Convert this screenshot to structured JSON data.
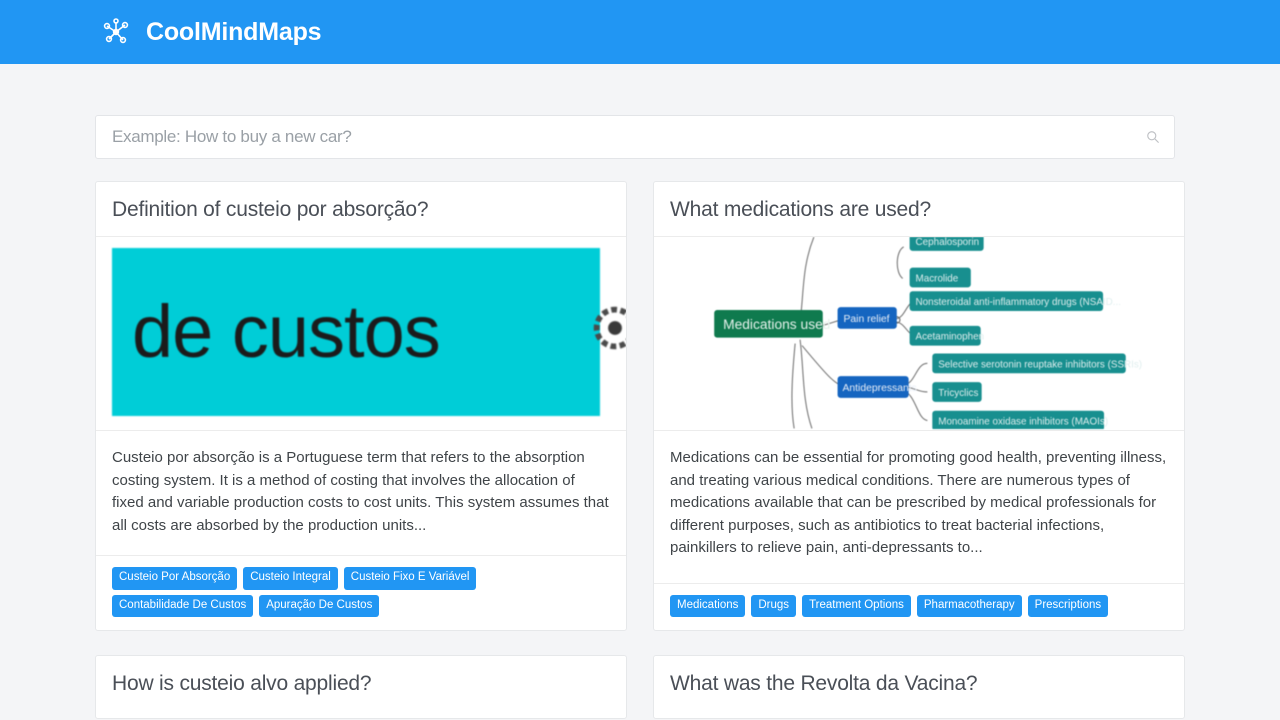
{
  "header": {
    "brand_name": "CoolMindMaps",
    "brand_icon": "network-nodes-icon",
    "background_color": "#2196f3"
  },
  "search": {
    "placeholder": "Example: How to buy a new car?",
    "value": "",
    "icon": "search-icon"
  },
  "theme": {
    "page_background": "#f4f5f7",
    "accent": "#2196f3",
    "card_background": "#ffffff",
    "tag_background": "#2196f3",
    "tag_text": "#ffffff"
  },
  "cards": [
    {
      "title": "Definition of custeio por absorção?",
      "thumbnail": {
        "type": "zoomed-text-banner",
        "text": "de custos",
        "background_color": "#00cdd7",
        "text_color": "#1b1b1b",
        "extra_icon": "gear-icon"
      },
      "description": "Custeio por absorção is a Portuguese term that refers to the absorption costing system. It is a method of costing that involves the allocation of fixed and variable production costs to cost units. This system assumes that all costs are absorbed by the production units...",
      "tags": [
        "Custeio Por Absorção",
        "Custeio Integral",
        "Custeio Fixo E Variável",
        "Contabilidade De Custos",
        "Apuração De Custos"
      ]
    },
    {
      "title": "What medications are used?",
      "thumbnail": {
        "type": "mindmap",
        "root": "Medications used",
        "root_color": "#0f7a4e",
        "branch_color": "#1565c0",
        "leaf_color": "#188f8f",
        "branches": [
          {
            "label": "Pain relief",
            "leaves": [
              "Nonsteroidal anti-inflammatory drugs (NSAID...",
              "Acetaminophen"
            ]
          },
          {
            "label": "Antidepressants",
            "leaves": [
              "Selective serotonin reuptake inhibitors (SSRIs)",
              "Tricyclics",
              "Monoamine oxidase inhibitors (MAOIs)"
            ]
          }
        ],
        "orphan_leaves": [
          "Cephalosporin",
          "Macrolide"
        ]
      },
      "description": "Medications can be essential for promoting good health, preventing illness, and treating various medical conditions. There are numerous types of medications available that can be prescribed by medical professionals for different purposes, such as antibiotics to treat bacterial infections, painkillers to relieve pain, anti-depressants to...",
      "tags": [
        "Medications",
        "Drugs",
        "Treatment Options",
        "Pharmacotherapy",
        "Prescriptions"
      ]
    },
    {
      "title": "How is custeio alvo applied?"
    },
    {
      "title": "What was the Revolta da Vacina?"
    }
  ]
}
